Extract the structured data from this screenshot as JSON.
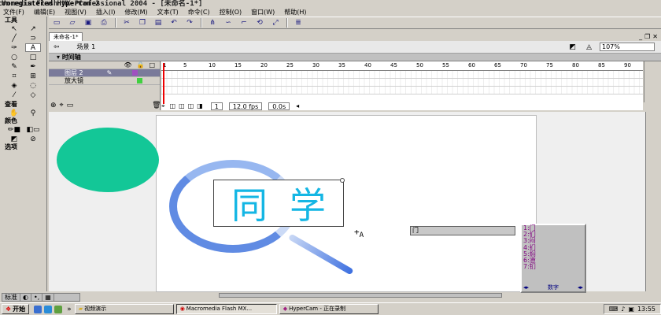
{
  "hypercam_banner": "Unregistered HyperCam 2",
  "window_title": "Macromedia Flash MX Professional 2004 - [未命名-1*]",
  "menu": [
    "文件(F)",
    "编辑(E)",
    "视图(V)",
    "插入(I)",
    "修改(M)",
    "文本(T)",
    "命令(C)",
    "控制(O)",
    "窗口(W)",
    "帮助(H)"
  ],
  "toolbar_icons": [
    "new-icon",
    "open-icon",
    "save-icon",
    "print-icon",
    "cut-icon",
    "copy-icon",
    "paste-icon",
    "undo-icon",
    "redo-icon",
    "snap-icon",
    "smooth-icon",
    "straighten-icon",
    "rotate-icon",
    "scale-icon",
    "align-icon"
  ],
  "tools": {
    "header": "工具",
    "items": [
      "↖",
      "↗",
      "╱",
      "⊃",
      "○",
      "□",
      "✎",
      "✒",
      "⌗",
      "⊞",
      "◈",
      "◌",
      "⁄",
      "◇"
    ],
    "view_label": "查看",
    "color_label": "颜色",
    "options_label": "选项"
  },
  "document": {
    "tab": "未命名-1*"
  },
  "scene": {
    "label": "场景 1",
    "zoom": "107%"
  },
  "timeline": {
    "header": "时间轴",
    "layers": [
      {
        "name": "图层 2",
        "selected": true,
        "color": "#a050c0"
      },
      {
        "name": "放大镜",
        "selected": false,
        "color": "#40d040"
      }
    ],
    "ruler": [
      "1",
      "5",
      "10",
      "15",
      "20",
      "25",
      "30",
      "35",
      "40",
      "45",
      "50",
      "55",
      "60",
      "65",
      "70",
      "75",
      "80",
      "85",
      "90"
    ],
    "frame": "1",
    "fps": "12.0 fps",
    "time": "0.0s"
  },
  "stage": {
    "text": [
      "同",
      "学"
    ],
    "circle_color": "#13c797",
    "text_color": "#14b6e4"
  },
  "ime": {
    "input": "门",
    "candidates": [
      "1:门",
      "2:们",
      "3:闷",
      "4:扪",
      "5:焖",
      "6:懑",
      "7:钔"
    ],
    "footer": "数字"
  },
  "ime_bar": [
    "标准",
    "◐",
    "•,",
    "▦"
  ],
  "taskbar": {
    "start": "开始",
    "tasks": [
      {
        "label": "视频演示",
        "active": false
      },
      {
        "label": "Macromedia Flash MX...",
        "active": true
      },
      {
        "label": "HyperCam - 正在录制",
        "active": false
      }
    ],
    "clock": "13:55"
  }
}
